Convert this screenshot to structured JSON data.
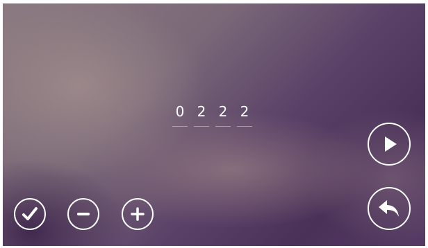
{
  "code_entry": {
    "digits": [
      "0",
      "2",
      "2",
      "2"
    ]
  },
  "buttons": {
    "confirm_icon": "checkmark-icon",
    "decrement_icon": "minus-icon",
    "increment_icon": "plus-icon",
    "play_icon": "play-icon",
    "back_icon": "back-arrow-icon"
  },
  "colors": {
    "icon": "#ffffff",
    "background_dark": "#4a3158",
    "background_light": "#8a7a80"
  }
}
